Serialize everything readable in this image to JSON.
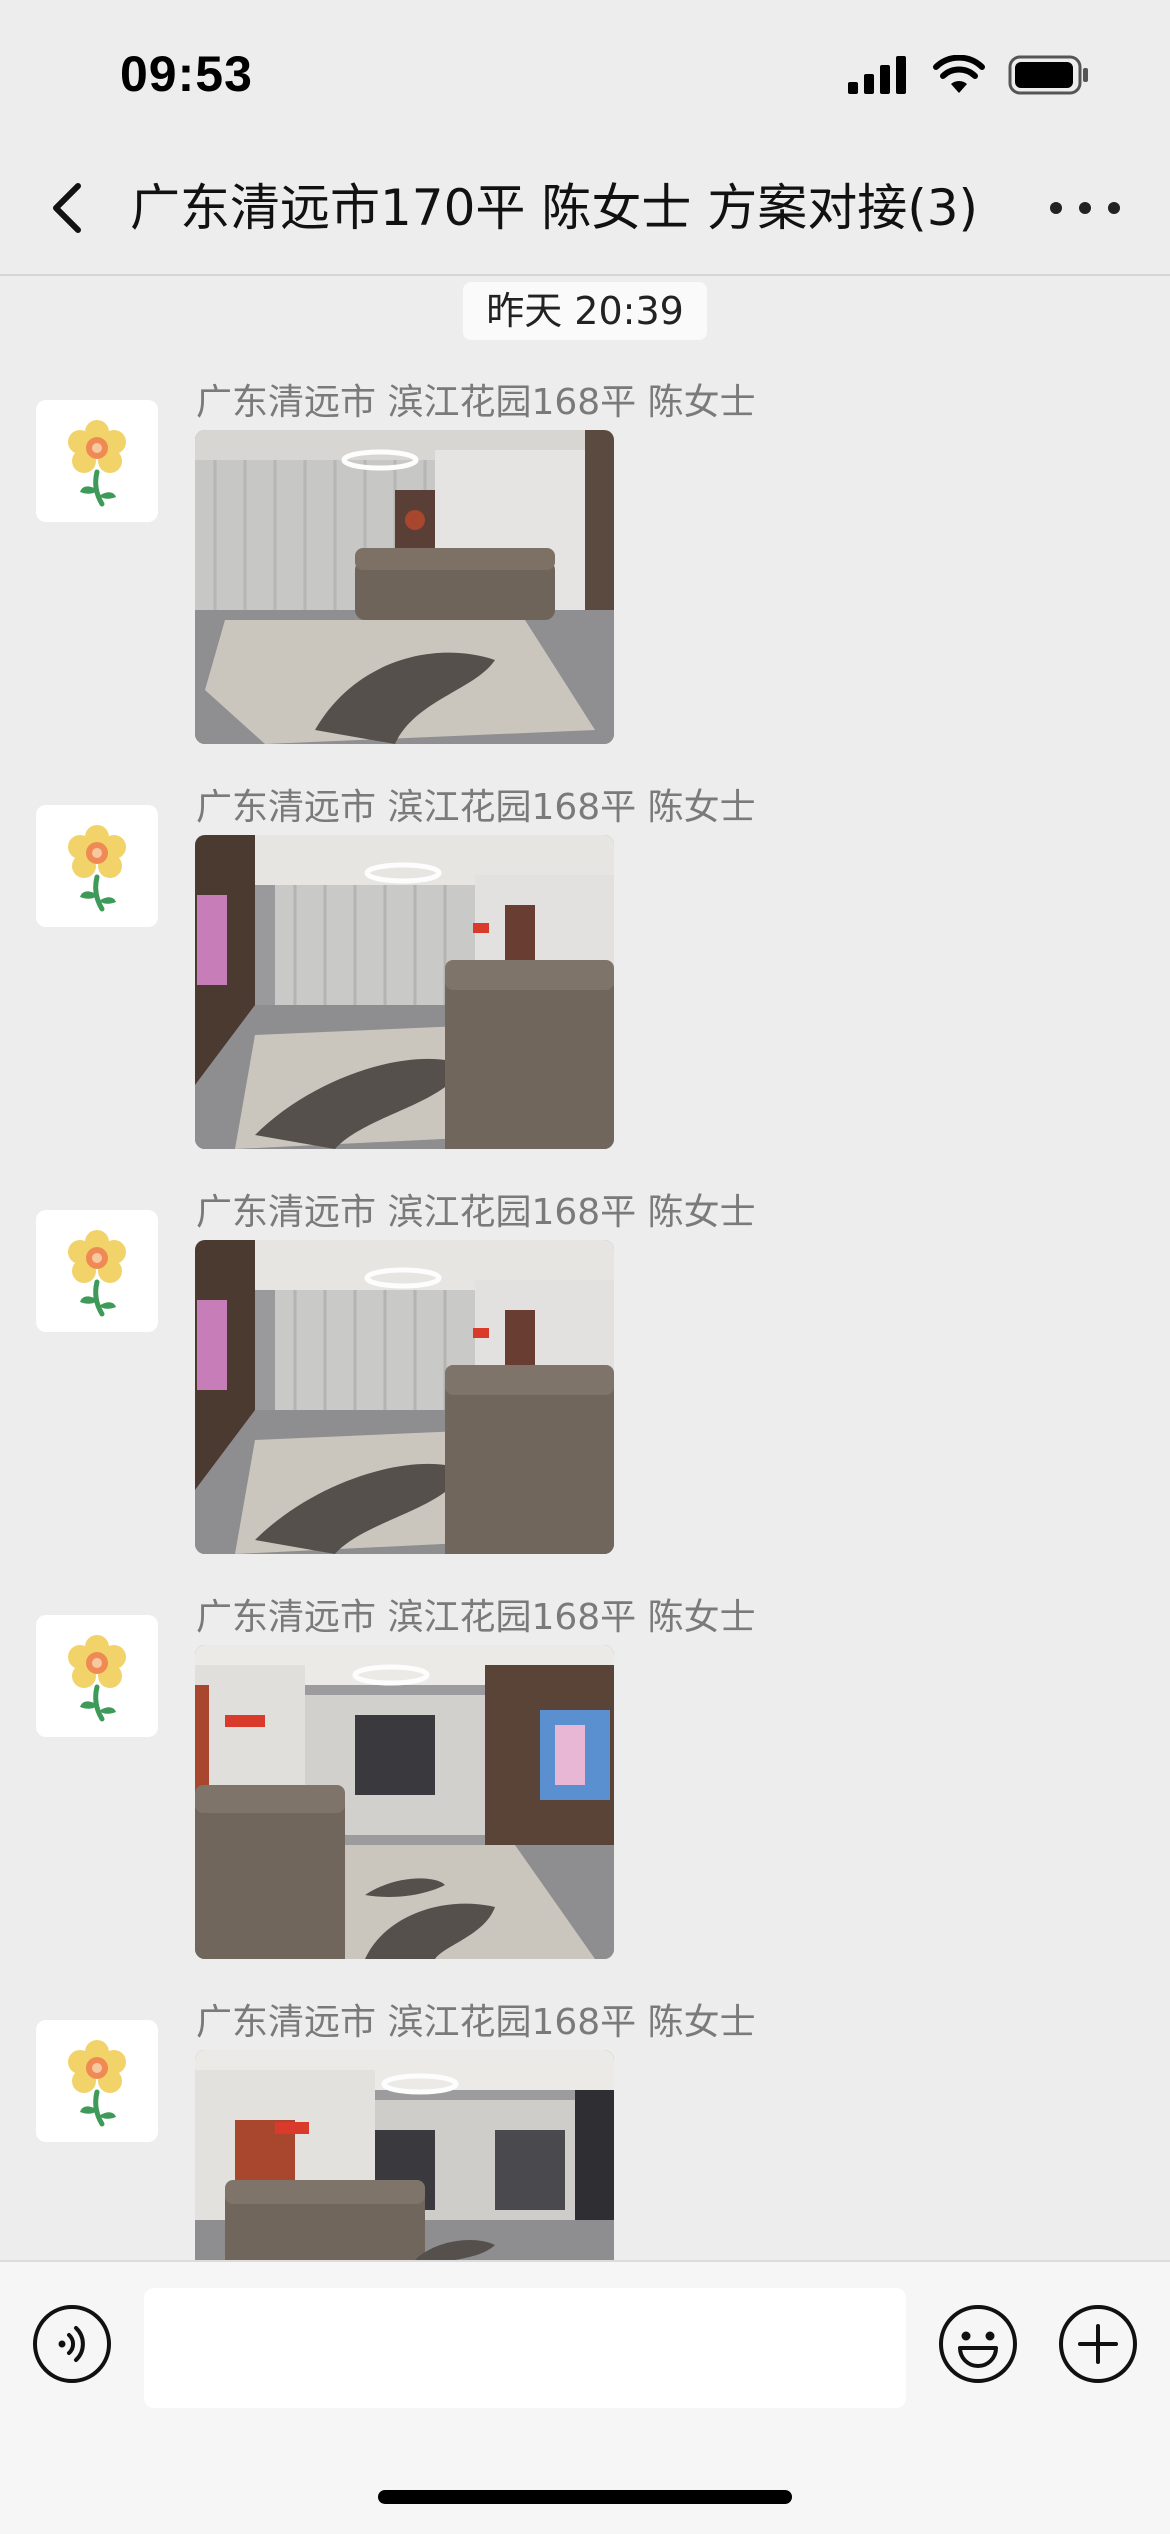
{
  "status_bar": {
    "time": "09:53"
  },
  "nav": {
    "title": "广东清远市170平 陈女士 方案对接(3)"
  },
  "timestamp": "昨天 20:39",
  "messages": [
    {
      "sender": "广东清远市 滨江花园168平 陈女士",
      "image": "living-room-photo"
    },
    {
      "sender": "广东清远市 滨江花园168平 陈女士",
      "image": "living-room-photo"
    },
    {
      "sender": "广东清远市 滨江花园168平 陈女士",
      "image": "living-room-photo"
    },
    {
      "sender": "广东清远市 滨江花园168平 陈女士",
      "image": "living-room-photo"
    },
    {
      "sender": "广东清远市 滨江花园168平 陈女士",
      "image": "living-room-photo"
    }
  ],
  "input": {
    "value": "",
    "placeholder": ""
  },
  "icons": {
    "back": "chevron-left-icon",
    "more": "more-dots-icon",
    "voice": "voice-icon",
    "emoji": "emoji-icon",
    "plus": "plus-icon"
  },
  "colors": {
    "background": "#ededed",
    "input_bar": "#f6f6f6",
    "sender_text": "#7a7a7a"
  }
}
